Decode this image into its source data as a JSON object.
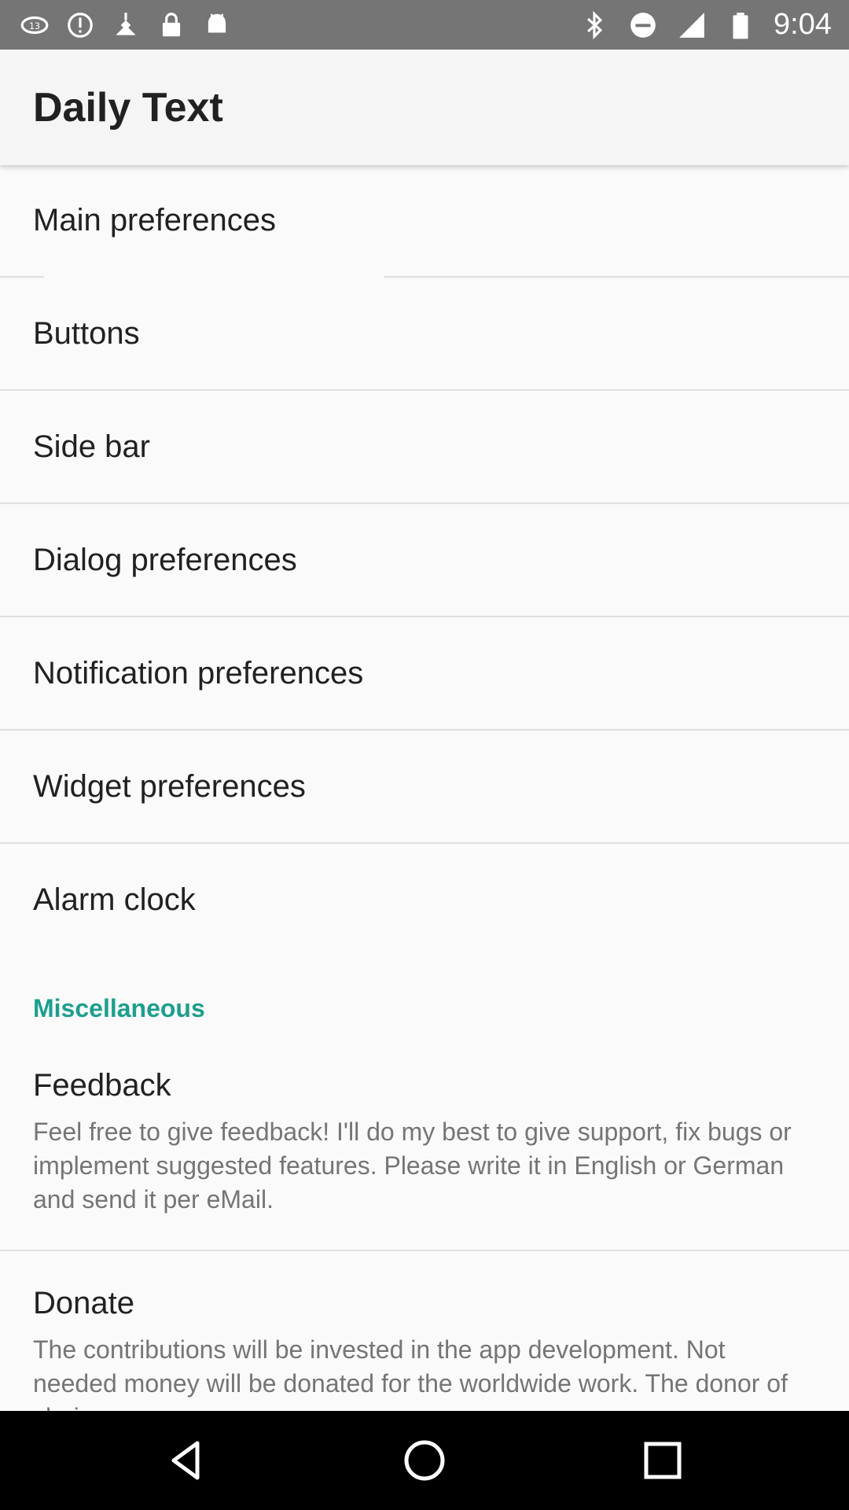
{
  "status_bar": {
    "time": "9:04",
    "left_icons": [
      "nfl-app-icon",
      "alert-icon",
      "fake-gps-icon",
      "lock-icon",
      "android-icon"
    ],
    "right_icons": [
      "bluetooth-icon",
      "do-not-disturb-icon",
      "signal-icon",
      "battery-icon"
    ]
  },
  "app_bar": {
    "title": "Daily Text"
  },
  "preferences": {
    "main": "Main preferences",
    "buttons": "Buttons",
    "side_bar": "Side bar",
    "dialog": "Dialog preferences",
    "notification": "Notification preferences",
    "widget": "Widget preferences",
    "alarm": "Alarm clock"
  },
  "misc": {
    "header": "Miscellaneous",
    "feedback_title": "Feedback",
    "feedback_summary": "Feel free to give feedback! I'll do my best to give support, fix bugs or implement suggested features. Please write it in English or German and send it per eMail.",
    "donate_title": "Donate",
    "donate_summary": "The contributions will be invested in the app development. Not needed money will be donated for the worldwide work. The donor of choice..."
  },
  "nav_bar": {
    "icons": [
      "back-icon",
      "home-icon",
      "recents-icon"
    ]
  },
  "colors": {
    "accent": "#1e9e8e",
    "status_bar": "#757575",
    "app_bar": "#f5f5f5",
    "background": "#fafafa"
  }
}
